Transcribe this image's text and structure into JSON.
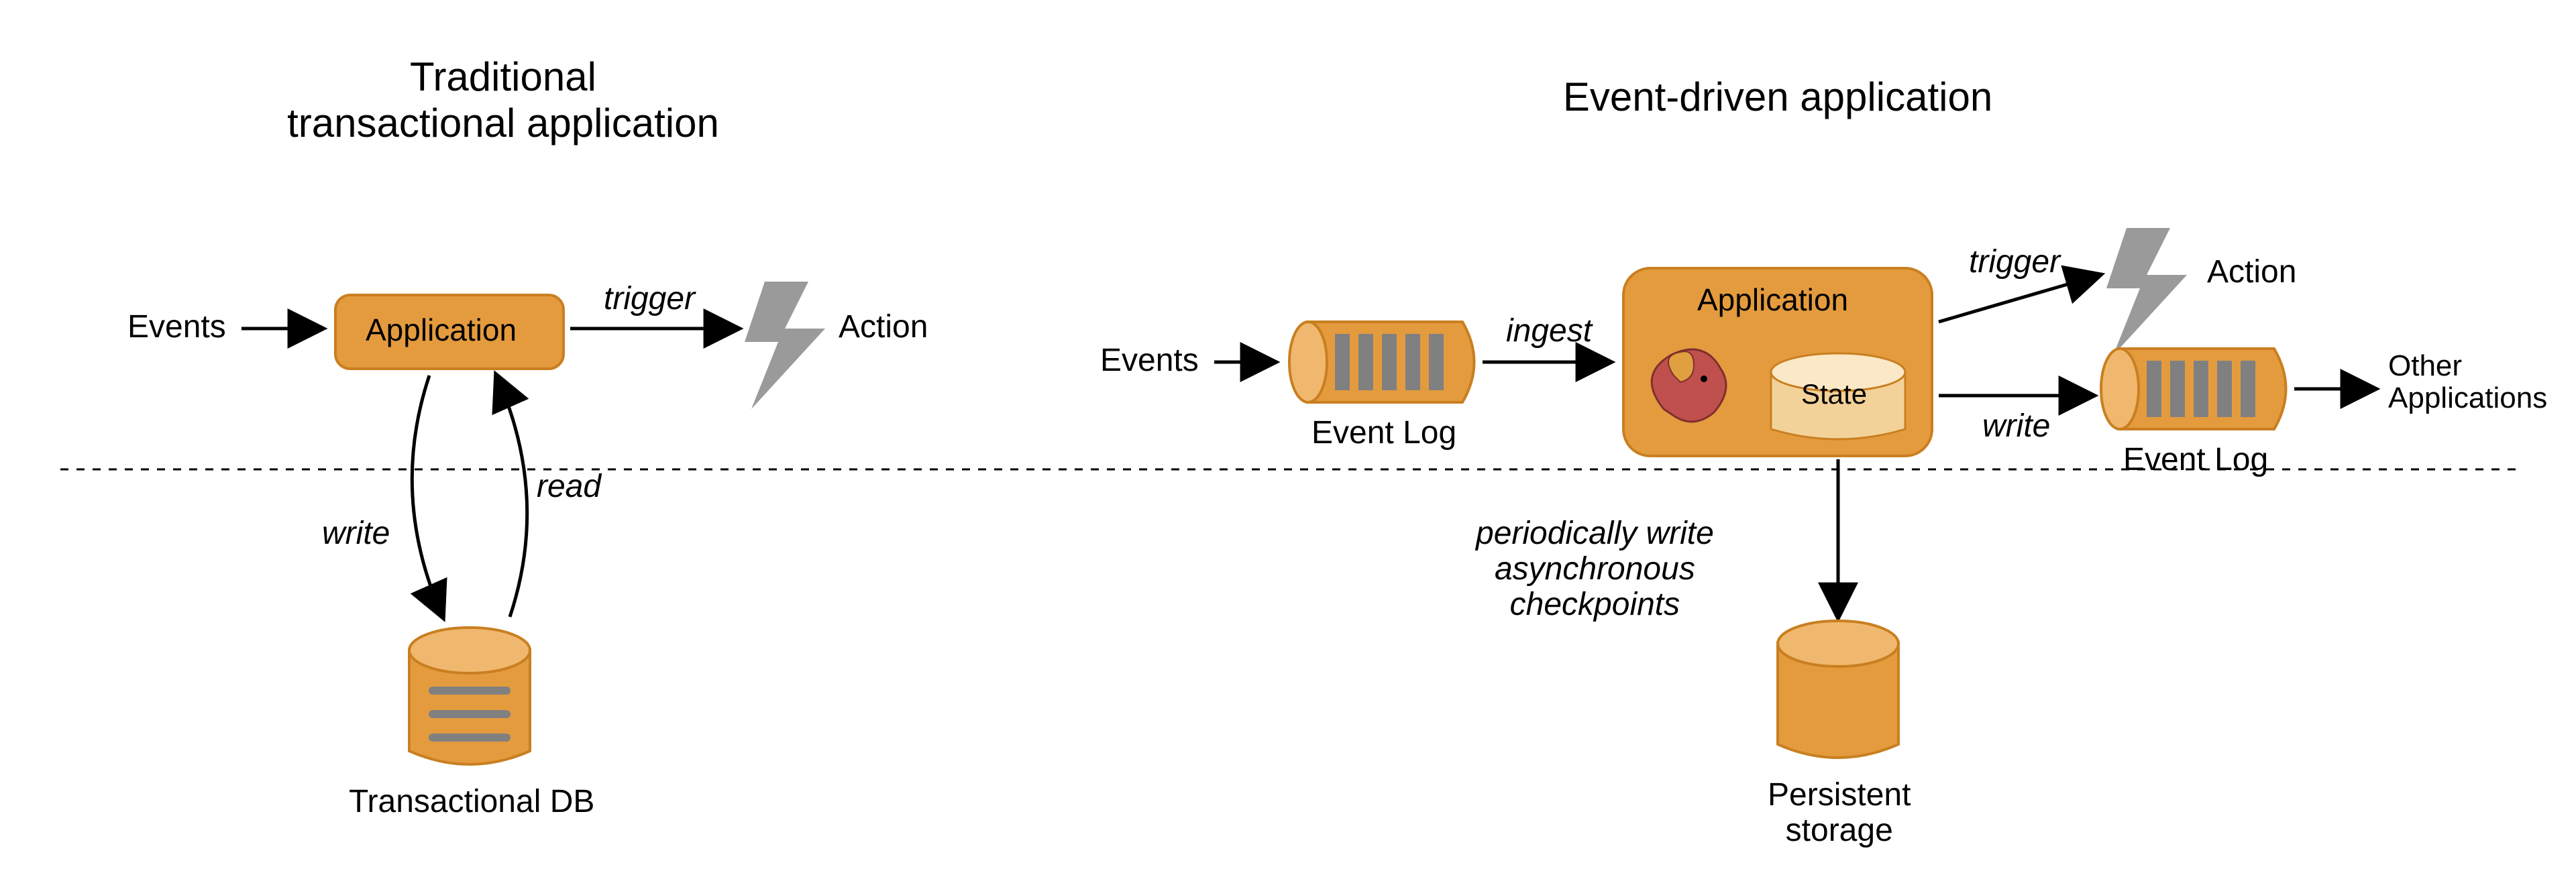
{
  "titles": {
    "left": "Traditional\ntransactional application",
    "right": "Event-driven application"
  },
  "labels": {
    "events_left": "Events",
    "app_left": "Application",
    "trigger_left": "trigger",
    "action_left": "Action",
    "read": "read",
    "write_db": "write",
    "transactional_db": "Transactional DB",
    "events_right": "Events",
    "event_log_in": "Event Log",
    "ingest": "ingest",
    "app_right": "Application",
    "state": "State",
    "trigger_right": "trigger",
    "action_right": "Action",
    "write_out": "write",
    "event_log_out": "Event Log",
    "other_apps": "Other\nApplications",
    "checkpoints": "periodically write\nasynchronous\ncheckpoints",
    "persistent_storage": "Persistent\nstorage"
  },
  "colors": {
    "orange": "#e49b3e",
    "orange_dark": "#c97f20",
    "orange_light": "#f0b86e",
    "gray": "#808080"
  }
}
